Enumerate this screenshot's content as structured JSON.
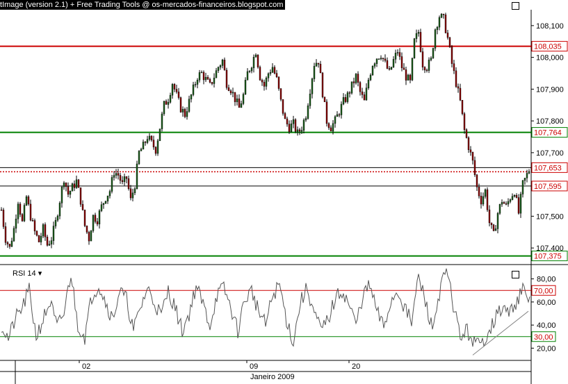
{
  "title": "tImage (version 2.1) + Free Trading Tools @ os-mercados-financeiros.blogspot.com",
  "colors": {
    "red": "#cc0000",
    "green": "#008000",
    "candle_down": "#8b0000",
    "candle_up": "#1a5c1a",
    "rsi": "#555555"
  },
  "chart_data": [
    {
      "type": "candlestick",
      "ylim": [
        107.35,
        108.15
      ],
      "yticks": [
        "108,100",
        "108,000",
        "107,900",
        "107,800",
        "107,700",
        "107,600",
        "107,500",
        "107,400"
      ],
      "ytick_values": [
        108.1,
        108.0,
        107.9,
        107.8,
        107.7,
        107.6,
        107.5,
        107.4
      ],
      "horizontal_lines": [
        {
          "label": "108,035",
          "value": 108.035,
          "color": "#cc0000",
          "style": "solid"
        },
        {
          "label": "107,764",
          "value": 107.764,
          "color": "#008000",
          "style": "solid"
        },
        {
          "label": "107,653",
          "value": 107.653,
          "color": "#000000",
          "style": "solid"
        },
        {
          "label": "",
          "value": 107.64,
          "color": "#cc0000",
          "style": "dotted"
        },
        {
          "label": "107,595",
          "value": 107.595,
          "color": "#000000",
          "style": "solid"
        },
        {
          "label": "107,375",
          "value": 107.375,
          "color": "#008000",
          "style": "solid"
        }
      ],
      "path": [
        [
          0,
          107.52
        ],
        [
          6,
          107.43
        ],
        [
          12,
          107.4
        ],
        [
          18,
          107.46
        ],
        [
          24,
          107.55
        ],
        [
          30,
          107.48
        ],
        [
          36,
          107.56
        ],
        [
          42,
          107.5
        ],
        [
          48,
          107.45
        ],
        [
          54,
          107.42
        ],
        [
          60,
          107.46
        ],
        [
          66,
          107.41
        ],
        [
          72,
          107.43
        ],
        [
          78,
          107.48
        ],
        [
          84,
          107.55
        ],
        [
          90,
          107.62
        ],
        [
          96,
          107.57
        ],
        [
          102,
          107.59
        ],
        [
          108,
          107.61
        ],
        [
          114,
          107.55
        ],
        [
          120,
          107.47
        ],
        [
          126,
          107.43
        ],
        [
          132,
          107.5
        ],
        [
          138,
          107.49
        ],
        [
          144,
          107.53
        ],
        [
          150,
          107.56
        ],
        [
          156,
          107.58
        ],
        [
          162,
          107.64
        ],
        [
          168,
          107.63
        ],
        [
          174,
          107.6
        ],
        [
          180,
          107.62
        ],
        [
          186,
          107.55
        ],
        [
          192,
          107.6
        ],
        [
          198,
          107.7
        ],
        [
          204,
          107.72
        ],
        [
          210,
          107.75
        ],
        [
          216,
          107.73
        ],
        [
          222,
          107.71
        ],
        [
          228,
          107.78
        ],
        [
          234,
          107.85
        ],
        [
          240,
          107.87
        ],
        [
          246,
          107.92
        ],
        [
          252,
          107.88
        ],
        [
          258,
          107.84
        ],
        [
          264,
          107.82
        ],
        [
          270,
          107.86
        ],
        [
          276,
          107.9
        ],
        [
          282,
          107.94
        ],
        [
          288,
          107.95
        ],
        [
          294,
          107.93
        ],
        [
          300,
          107.91
        ],
        [
          306,
          107.94
        ],
        [
          312,
          107.97
        ],
        [
          318,
          107.99
        ],
        [
          324,
          107.92
        ],
        [
          330,
          107.9
        ],
        [
          336,
          107.87
        ],
        [
          342,
          107.84
        ],
        [
          348,
          107.88
        ],
        [
          354,
          107.95
        ],
        [
          360,
          107.98
        ],
        [
          366,
          108.02
        ],
        [
          372,
          107.94
        ],
        [
          378,
          107.91
        ],
        [
          384,
          107.95
        ],
        [
          390,
          107.97
        ],
        [
          396,
          107.93
        ],
        [
          402,
          107.86
        ],
        [
          408,
          107.8
        ],
        [
          414,
          107.78
        ],
        [
          420,
          107.79
        ],
        [
          426,
          107.76
        ],
        [
          432,
          107.78
        ],
        [
          438,
          107.82
        ],
        [
          444,
          107.9
        ],
        [
          450,
          107.98
        ],
        [
          456,
          107.99
        ],
        [
          462,
          107.89
        ],
        [
          468,
          107.8
        ],
        [
          474,
          107.78
        ],
        [
          480,
          107.8
        ],
        [
          486,
          107.83
        ],
        [
          492,
          107.86
        ],
        [
          498,
          107.88
        ],
        [
          504,
          107.91
        ],
        [
          510,
          107.94
        ],
        [
          516,
          107.89
        ],
        [
          522,
          107.86
        ],
        [
          528,
          107.93
        ],
        [
          534,
          107.98
        ],
        [
          540,
          108.0
        ],
        [
          546,
          108.01
        ],
        [
          552,
          107.98
        ],
        [
          558,
          107.95
        ],
        [
          564,
          107.99
        ],
        [
          570,
          108.02
        ],
        [
          576,
          107.97
        ],
        [
          582,
          107.94
        ],
        [
          588,
          107.92
        ],
        [
          594,
          108.05
        ],
        [
          600,
          108.08
        ],
        [
          606,
          107.98
        ],
        [
          612,
          107.97
        ],
        [
          618,
          107.99
        ],
        [
          624,
          108.09
        ],
        [
          630,
          108.13
        ],
        [
          636,
          108.12
        ],
        [
          642,
          108.06
        ],
        [
          648,
          107.98
        ],
        [
          654,
          107.92
        ],
        [
          660,
          107.86
        ],
        [
          666,
          107.77
        ],
        [
          672,
          107.72
        ],
        [
          678,
          107.67
        ],
        [
          684,
          107.59
        ],
        [
          690,
          107.55
        ],
        [
          696,
          107.58
        ],
        [
          702,
          107.48
        ],
        [
          708,
          107.44
        ],
        [
          714,
          107.51
        ],
        [
          720,
          107.55
        ],
        [
          726,
          107.53
        ],
        [
          732,
          107.56
        ],
        [
          738,
          107.58
        ],
        [
          744,
          107.51
        ],
        [
          750,
          107.6
        ],
        [
          756,
          107.63
        ],
        [
          760,
          107.65
        ]
      ]
    },
    {
      "type": "line",
      "name": "RSI 14",
      "ylim": [
        10,
        90
      ],
      "yticks": [
        "80,00",
        "60,00",
        "40,00",
        "20,00"
      ],
      "ytick_values": [
        80,
        60,
        40,
        20
      ],
      "levels": [
        {
          "label": "70,00",
          "value": 70,
          "color": "#cc0000"
        },
        {
          "label": "30,00",
          "value": 30,
          "color": "#008000"
        }
      ],
      "trendline": [
        [
          680,
          14
        ],
        [
          760,
          52
        ]
      ],
      "x": [
        0,
        10,
        20,
        30,
        40,
        50,
        60,
        70,
        80,
        90,
        100,
        110,
        120,
        130,
        140,
        150,
        160,
        170,
        180,
        190,
        200,
        210,
        220,
        230,
        240,
        250,
        260,
        270,
        280,
        290,
        300,
        310,
        320,
        330,
        340,
        350,
        360,
        370,
        380,
        390,
        400,
        410,
        420,
        430,
        440,
        450,
        460,
        470,
        480,
        490,
        500,
        510,
        520,
        530,
        540,
        550,
        560,
        570,
        580,
        590,
        600,
        610,
        620,
        630,
        640,
        650,
        660,
        670,
        680,
        690,
        700,
        710,
        720,
        730,
        740,
        750,
        760
      ],
      "values": [
        40,
        28,
        45,
        55,
        70,
        30,
        45,
        60,
        38,
        50,
        85,
        40,
        30,
        65,
        75,
        60,
        45,
        70,
        62,
        35,
        55,
        72,
        60,
        48,
        70,
        55,
        35,
        50,
        74,
        58,
        40,
        66,
        72,
        55,
        35,
        62,
        70,
        52,
        40,
        65,
        75,
        45,
        25,
        60,
        72,
        50,
        35,
        45,
        62,
        70,
        58,
        40,
        66,
        74,
        52,
        38,
        60,
        70,
        55,
        42,
        82,
        60,
        36,
        68,
        88,
        58,
        30,
        35,
        25,
        22,
        35,
        45,
        55,
        50,
        60,
        70,
        60
      ]
    }
  ],
  "x_axis": {
    "ticks": [
      "02",
      "09",
      "20"
    ],
    "month": "Janeiro 2009"
  },
  "rsi_label": "RSI 14"
}
